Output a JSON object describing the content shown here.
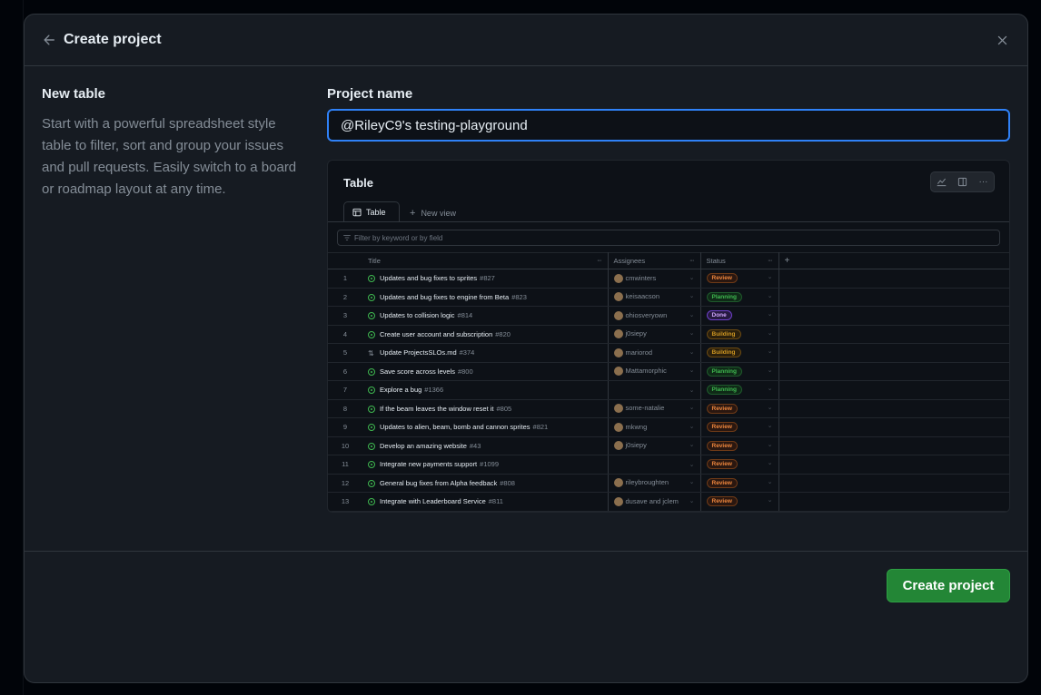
{
  "dialog": {
    "title": "Create project",
    "back_icon": "arrow-left-icon",
    "close_icon": "x-icon"
  },
  "layout": {
    "title": "New table",
    "description": "Start with a powerful spreadsheet style table to filter, sort and group your issues and pull requests. Easily switch to a board or roadmap layout at any time."
  },
  "form": {
    "project_name_label": "Project name",
    "project_name_value": "@RileyC9's testing-playground"
  },
  "preview": {
    "title": "Table",
    "tabs": {
      "active": "Table",
      "new_view": "New view"
    },
    "filter_placeholder": "Filter by keyword or by field",
    "columns": {
      "title": "Title",
      "assignees": "Assignees",
      "status": "Status"
    },
    "rows": [
      {
        "n": "1",
        "title": "Updates and bug fixes to sprites",
        "num": "#827",
        "assignee": "cmwinters",
        "status": "Review",
        "kind": "review",
        "icon": "issue"
      },
      {
        "n": "2",
        "title": "Updates and bug fixes to engine from Beta",
        "num": "#823",
        "assignee": "keisaacson",
        "status": "Planning",
        "kind": "planning",
        "icon": "issue"
      },
      {
        "n": "3",
        "title": "Updates to collision logic",
        "num": "#814",
        "assignee": "ohiosveryown",
        "status": "Done",
        "kind": "done",
        "icon": "issue"
      },
      {
        "n": "4",
        "title": "Create user account and subscription",
        "num": "#820",
        "assignee": "j0siepy",
        "status": "Building",
        "kind": "building",
        "icon": "issue"
      },
      {
        "n": "5",
        "title": "Update ProjectsSLOs.md",
        "num": "#374",
        "assignee": "mariorod",
        "status": "Building",
        "kind": "building",
        "icon": "pr"
      },
      {
        "n": "6",
        "title": "Save score across levels",
        "num": "#800",
        "assignee": "Mattamorphic",
        "status": "Planning",
        "kind": "planning",
        "icon": "issue"
      },
      {
        "n": "7",
        "title": "Explore a bug",
        "num": "#1366",
        "assignee": "",
        "status": "Planning",
        "kind": "planning",
        "icon": "issue"
      },
      {
        "n": "8",
        "title": "If the beam leaves the window reset it",
        "num": "#805",
        "assignee": "some-natalie",
        "status": "Review",
        "kind": "review",
        "icon": "issue"
      },
      {
        "n": "9",
        "title": "Updates to alien, beam, bomb and cannon sprites",
        "num": "#821",
        "assignee": "mkwng",
        "status": "Review",
        "kind": "review",
        "icon": "issue"
      },
      {
        "n": "10",
        "title": "Develop an amazing website",
        "num": "#43",
        "assignee": "j0siepy",
        "status": "Review",
        "kind": "review",
        "icon": "issue"
      },
      {
        "n": "11",
        "title": "Integrate new payments support",
        "num": "#1099",
        "assignee": "",
        "status": "Review",
        "kind": "review",
        "icon": "issue"
      },
      {
        "n": "12",
        "title": "General bug fixes from Alpha feedback",
        "num": "#808",
        "assignee": "rileybroughten",
        "status": "Review",
        "kind": "review",
        "icon": "issue"
      },
      {
        "n": "13",
        "title": "Integrate with Leaderboard Service",
        "num": "#811",
        "assignee": "dusave and jclem",
        "status": "Review",
        "kind": "review",
        "icon": "issue"
      }
    ]
  },
  "footer": {
    "create_label": "Create project"
  },
  "colors": {
    "accent": "#2f81f7",
    "primary_button": "#238636",
    "background": "#161b22"
  }
}
